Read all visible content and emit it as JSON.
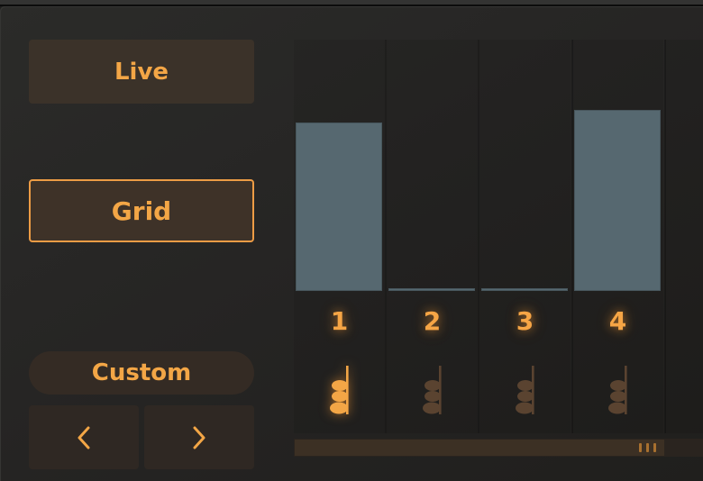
{
  "mode_buttons": {
    "live_label": "Live",
    "grid_label": "Grid",
    "selected": "Grid"
  },
  "preset": {
    "label": "Custom",
    "prev_icon": "chevron-left-icon",
    "next_icon": "chevron-right-icon"
  },
  "steps": [
    {
      "number": "1",
      "value": 0.67,
      "note": "triplet-note-icon",
      "active": true
    },
    {
      "number": "2",
      "value": 0.01,
      "note": "triplet-note-icon",
      "active": false
    },
    {
      "number": "3",
      "value": 0.01,
      "note": "triplet-note-icon",
      "active": false
    },
    {
      "number": "4",
      "value": 0.72,
      "note": "triplet-note-icon",
      "active": false
    }
  ],
  "colors": {
    "accent": "#f3a646",
    "bar": "#566870",
    "note_inactive": "#5a4330",
    "button_bg": "#3b3229"
  },
  "scrollbar": {
    "position": 0.0,
    "visible_fraction": 0.9
  }
}
